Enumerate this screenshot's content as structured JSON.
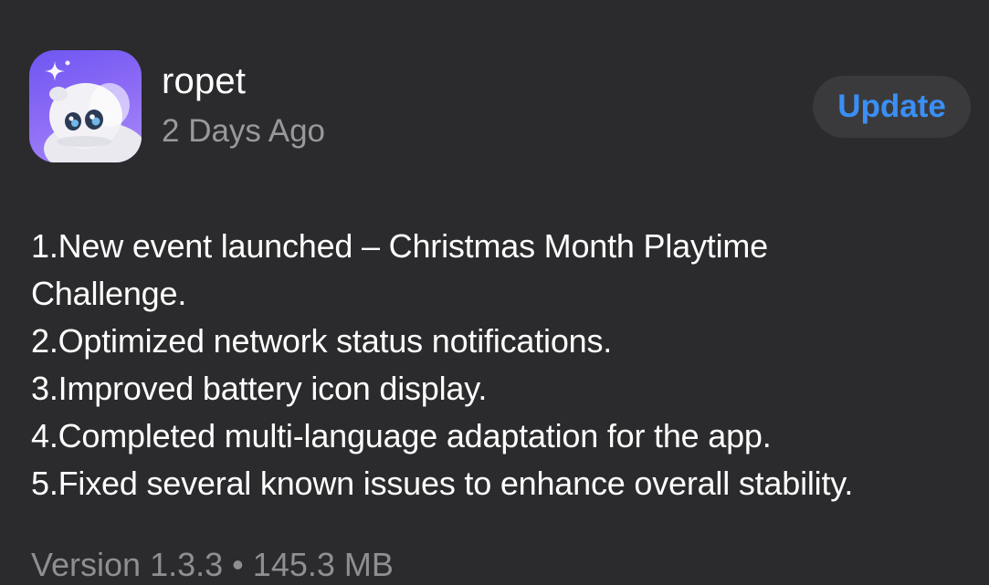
{
  "app": {
    "name": "ropet",
    "date": "2 Days Ago",
    "icon": "ropet-app-icon",
    "update_label": "Update"
  },
  "release_notes": [
    "1.New event launched – Christmas Month Playtime",
    "Challenge.",
    "2.Optimized network status notifications.",
    "3.Improved battery icon display.",
    "4.Completed multi-language adaptation for the app.",
    "5.Fixed several known issues to enhance overall stability."
  ],
  "version": {
    "label": "Version 1.3.3",
    "separator": "•",
    "size": "145.3 MB"
  },
  "colors": {
    "background": "#2b2b2d",
    "accent": "#3a8ff5",
    "secondary_text": "#98989d",
    "button_bg": "#3a3a3d"
  }
}
